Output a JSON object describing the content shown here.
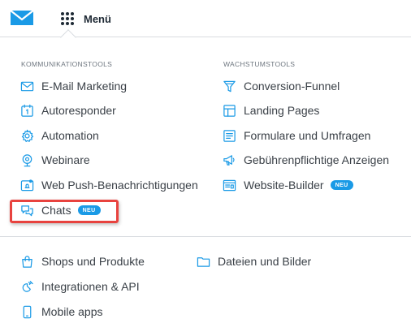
{
  "header": {
    "menu_label": "Menü"
  },
  "sections": {
    "kommunikation": {
      "title": "KOMMUNIKATIONSTOOLS",
      "items": [
        {
          "label": "E-Mail Marketing",
          "icon": "envelope-icon"
        },
        {
          "label": "Autoresponder",
          "icon": "calendar-icon"
        },
        {
          "label": "Automation",
          "icon": "gear-icon"
        },
        {
          "label": "Webinare",
          "icon": "webinar-icon"
        },
        {
          "label": "Web Push-Benachrichtigungen",
          "icon": "push-notification-icon"
        },
        {
          "label": "Chats",
          "icon": "chat-icon",
          "badge": "NEU"
        }
      ]
    },
    "wachstum": {
      "title": "WACHSTUMSTOOLS",
      "items": [
        {
          "label": "Conversion-Funnel",
          "icon": "funnel-icon"
        },
        {
          "label": "Landing Pages",
          "icon": "layout-icon"
        },
        {
          "label": "Formulare und Umfragen",
          "icon": "form-icon"
        },
        {
          "label": "Gebührenpflichtige Anzeigen",
          "icon": "megaphone-icon"
        },
        {
          "label": "Website-Builder",
          "icon": "browser-icon",
          "badge": "NEU"
        }
      ]
    },
    "extras": {
      "items": [
        {
          "label": "Shops und Produkte",
          "icon": "shopping-bag-icon"
        },
        {
          "label": "Integrationen & API",
          "icon": "plug-icon"
        },
        {
          "label": "Mobile apps",
          "icon": "smartphone-icon"
        },
        {
          "label": "Dateien und Bilder",
          "icon": "folder-icon"
        }
      ]
    }
  },
  "colors": {
    "accent": "#1a9ae6",
    "highlight": "#e8433f",
    "text": "#3a4047"
  }
}
